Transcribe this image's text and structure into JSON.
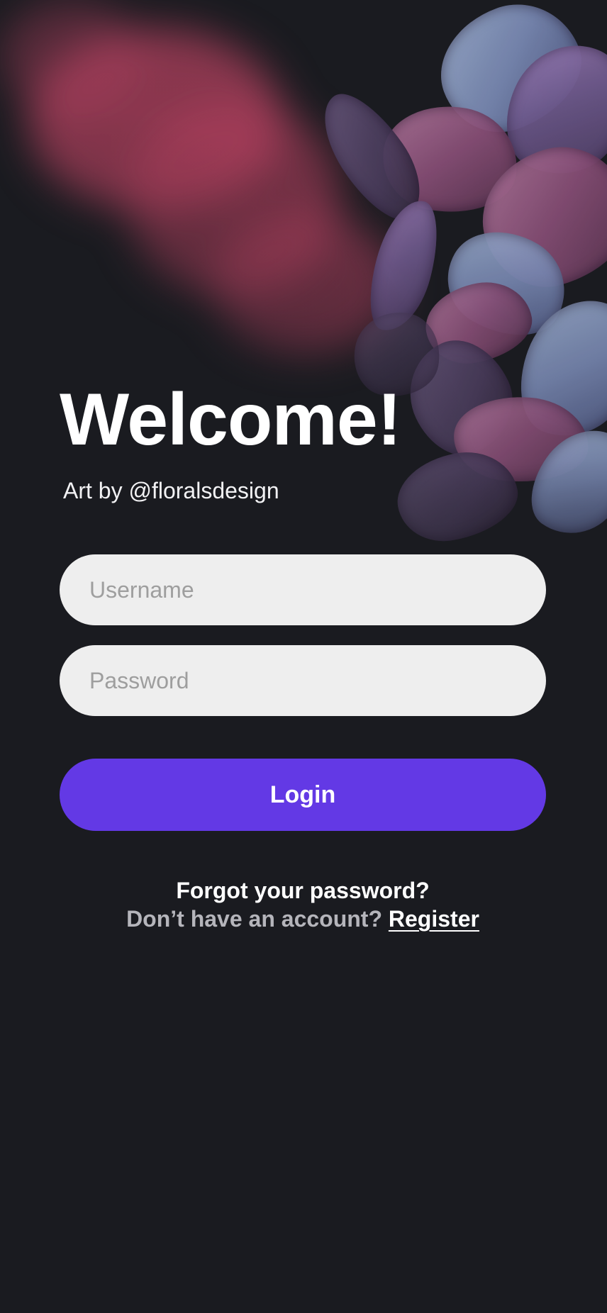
{
  "background": {
    "art": "hydrangea-flowers-photo",
    "base_color": "#1a1b20"
  },
  "header": {
    "title": "Welcome!",
    "credit": "Art by @floralsdesign"
  },
  "form": {
    "username_placeholder": "Username",
    "username_value": "",
    "password_placeholder": "Password",
    "password_value": "",
    "login_label": "Login",
    "login_color": "#6339e5",
    "field_color": "#eeeeee"
  },
  "footer": {
    "forgot_label": "Forgot your password?",
    "no_account_label": "Don’t have an account?",
    "register_label": "Register"
  }
}
